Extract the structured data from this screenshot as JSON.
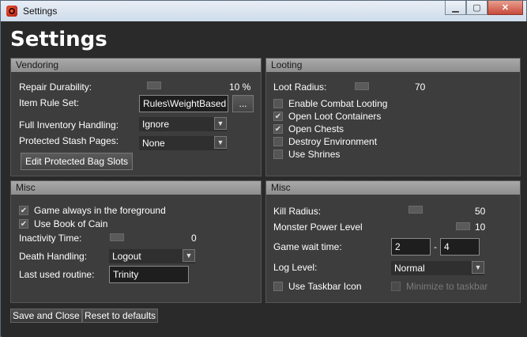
{
  "window": {
    "title": "Settings"
  },
  "header": {
    "title": "Settings"
  },
  "vendoring": {
    "header": "Vendoring",
    "repair_label": "Repair Durability:",
    "repair_value": "10 %",
    "repair_level": 0.1,
    "rule_set_label": "Item Rule Set:",
    "rule_set_value": "Rules\\WeightBased",
    "browse_label": "...",
    "full_inventory_label": "Full Inventory Handling:",
    "full_inventory_value": "Ignore",
    "stash_label": "Protected Stash Pages:",
    "stash_value": "None",
    "edit_button": "Edit Protected Bag Slots"
  },
  "looting": {
    "header": "Looting",
    "radius_label": "Loot Radius:",
    "radius_value": "70",
    "options": [
      {
        "label": "Enable Combat Looting",
        "checked": false
      },
      {
        "label": "Open Loot Containers",
        "checked": true
      },
      {
        "label": "Open Chests",
        "checked": true
      },
      {
        "label": "Destroy Environment",
        "checked": false
      },
      {
        "label": "Use Shrines",
        "checked": false
      }
    ]
  },
  "misc_left": {
    "header": "Misc",
    "options": [
      {
        "label": "Game always in the foreground",
        "checked": true
      },
      {
        "label": "Use Book of Cain",
        "checked": true
      }
    ],
    "inactivity_label": "Inactivity Time:",
    "inactivity_value": "0",
    "death_label": "Death Handling:",
    "death_value": "Logout",
    "routine_label": "Last used routine:",
    "routine_value": "Trinity"
  },
  "misc_right": {
    "header": "Misc",
    "kill_radius_label": "Kill Radius:",
    "kill_radius_value": "50",
    "monster_power_label": "Monster Power Level",
    "monster_power_value": "10",
    "wait_label": "Game wait time:",
    "wait_min": "2",
    "wait_sep": "-",
    "wait_max": "4",
    "log_label": "Log Level:",
    "log_value": "Normal",
    "taskbar_icon_label": "Use Taskbar Icon",
    "taskbar_icon_checked": false,
    "minimize_label": "Minimize to taskbar",
    "minimize_checked": false
  },
  "footer": {
    "save_label": "Save and Close",
    "reset_label": "Reset to defaults"
  },
  "colors": {
    "background": "#2a2a2a",
    "panel": "#3d3d3d",
    "header": "#a0a0a0"
  }
}
